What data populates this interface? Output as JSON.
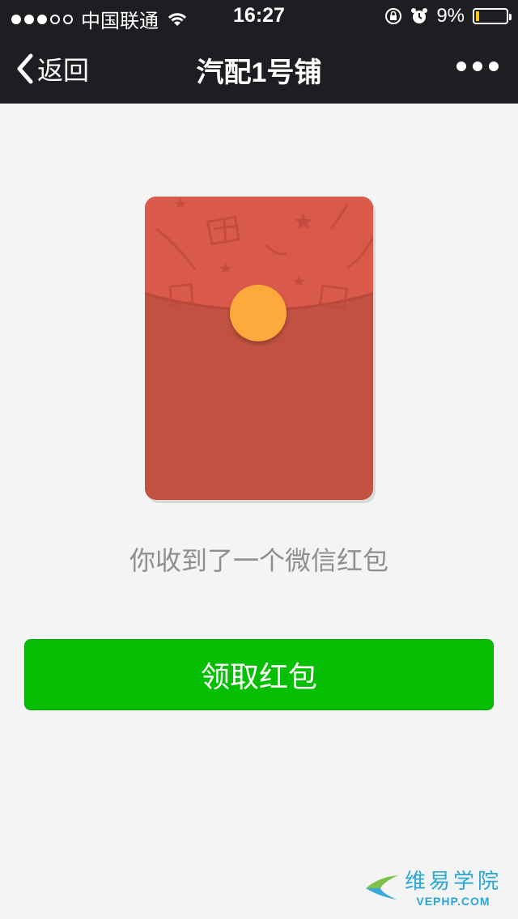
{
  "status_bar": {
    "carrier": "中国联通",
    "time": "16:27",
    "battery_percent": "9%",
    "icons": [
      "signal-dots-icon",
      "wifi-icon",
      "rotation-lock-icon",
      "alarm-icon",
      "battery-icon"
    ]
  },
  "nav": {
    "back_label": "返回",
    "title": "汽配1号铺",
    "more_icon": "ellipsis-icon"
  },
  "envelope": {
    "icon": "red-envelope-icon",
    "colors": {
      "body": "#c15140",
      "flap": "#d9594b",
      "coin": "#fea93b"
    }
  },
  "caption": "你收到了一个微信红包",
  "button": {
    "label": "领取红包",
    "color": "#06be04"
  },
  "watermark": {
    "name": "维易学院",
    "site": "VEPHP.COM"
  }
}
